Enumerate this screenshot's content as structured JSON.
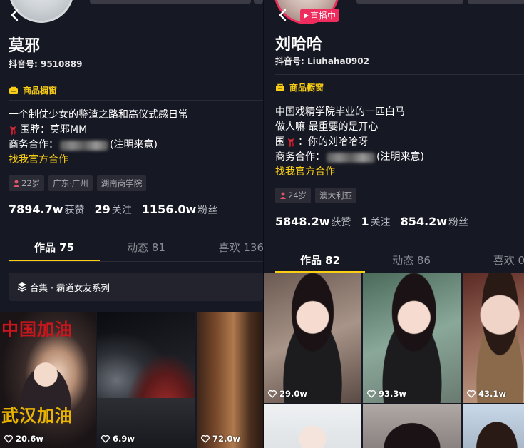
{
  "left": {
    "name": "莫邪",
    "douyin_id": "抖音号: 9510889",
    "shop_label": "商品橱窗",
    "bio": {
      "line1": "一个制仗少女的鉴渣之路和高仪式感日常",
      "line2_text": "围脖：莫邪MM",
      "line3_prefix": "商务合作：",
      "line3_suffix": "(注明来意)",
      "official": "找我官方合作"
    },
    "tags": [
      "22岁",
      "广东·广州",
      "湖南商学院"
    ],
    "stats": [
      {
        "num": "7894.7w",
        "label": "获赞"
      },
      {
        "num": "29",
        "label": "关注"
      },
      {
        "num": "1156.0w",
        "label": "粉丝"
      }
    ],
    "tabs": [
      "作品 75",
      "动态 81",
      "喜欢 136"
    ],
    "collection": "合集 · 霸道女友系列",
    "thumbs": [
      {
        "likes": "20.6w",
        "overlay_top": "中国加油",
        "overlay_bottom": "武汉加油"
      },
      {
        "likes": "6.9w"
      },
      {
        "likes": "72.0w"
      }
    ]
  },
  "right": {
    "name": "刘哈哈",
    "douyin_id": "抖音号: Liuhaha0902",
    "live_badge": "直播中",
    "shop_label": "商品橱窗",
    "bio": {
      "line1": "中国戏精学院毕业的一匹白马",
      "line2": "做人嘛 最重要的是开心",
      "line3_prefix": "围",
      "line3_suffix": "：你的刘哈哈呀",
      "line4_prefix": "商务合作：",
      "line4_suffix": "(注明来意)",
      "official": "找我官方合作"
    },
    "tags": [
      "24岁",
      "澳大利亚"
    ],
    "stats": [
      {
        "num": "5848.2w",
        "label": "获赞"
      },
      {
        "num": "1",
        "label": "关注"
      },
      {
        "num": "854.2w",
        "label": "粉丝"
      }
    ],
    "tabs": [
      "作品 82",
      "动态 86",
      "喜欢 0"
    ],
    "thumbs": [
      {
        "likes": "29.0w"
      },
      {
        "likes": "93.3w"
      },
      {
        "likes": "43.1w"
      }
    ]
  },
  "colors": {
    "background": "#161823",
    "accent_yellow": "#face15",
    "live_pink": "#ee2c5d",
    "muted_text": "#8a8b93"
  },
  "icons": [
    "back-arrow-icon",
    "shop-window-icon",
    "scarf-icon",
    "gender-female-icon",
    "layers-icon",
    "heart-icon",
    "live-play-icon"
  ]
}
